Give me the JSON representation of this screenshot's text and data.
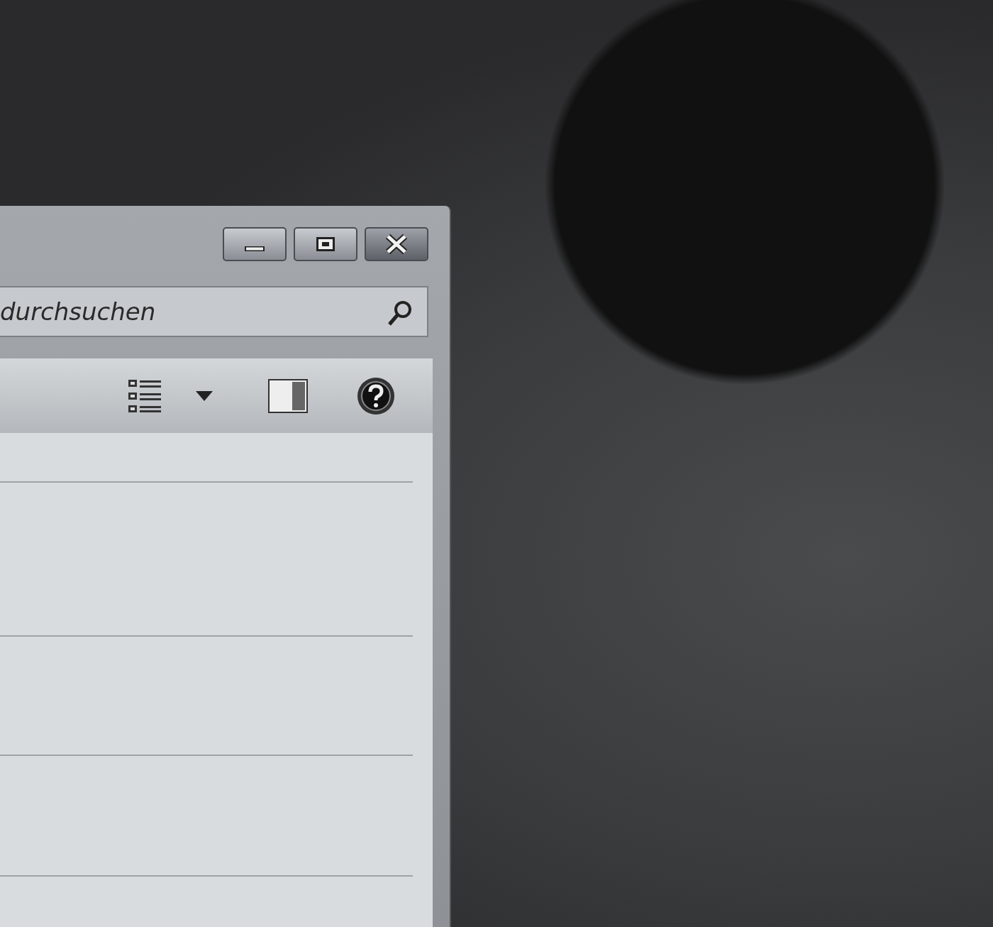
{
  "search": {
    "placeholder": "durchsuchen"
  }
}
